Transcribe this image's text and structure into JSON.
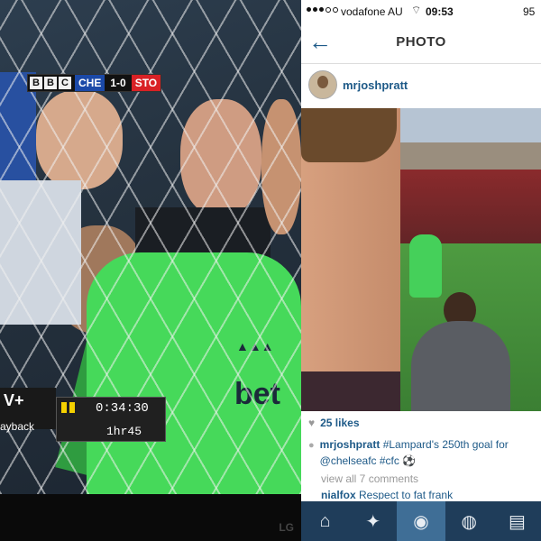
{
  "tv": {
    "scoreboard": {
      "broadcaster": [
        "B",
        "B",
        "C"
      ],
      "home_team": "CHE",
      "score": "1-0",
      "away_team": "STO"
    },
    "service_label": "V+",
    "mode_label": "ayback",
    "time": "0:34:30",
    "duration": "1hr45",
    "shirt_sponsor": "bet",
    "brand_logo": "LG"
  },
  "status_bar": {
    "carrier": "vodafone AU",
    "time": "09:53",
    "battery": "95"
  },
  "nav": {
    "title": "PHOTO"
  },
  "post": {
    "username": "mrjoshpratt",
    "likes": "25 likes",
    "caption_user": "mrjoshpratt",
    "caption_text": "#Lampard's 250th goal for @chelseafc #cfc",
    "comments_link": "view all 7 comments",
    "comment_user": "nialfox",
    "comment_text": "Respect to fat frank"
  },
  "tabs": [
    {
      "icon": "home-icon",
      "glyph": "⌂"
    },
    {
      "icon": "explore-icon",
      "glyph": "✦"
    },
    {
      "icon": "camera-icon",
      "glyph": "◉"
    },
    {
      "icon": "activity-icon",
      "glyph": "◍"
    },
    {
      "icon": "profile-icon",
      "glyph": "▤"
    }
  ]
}
